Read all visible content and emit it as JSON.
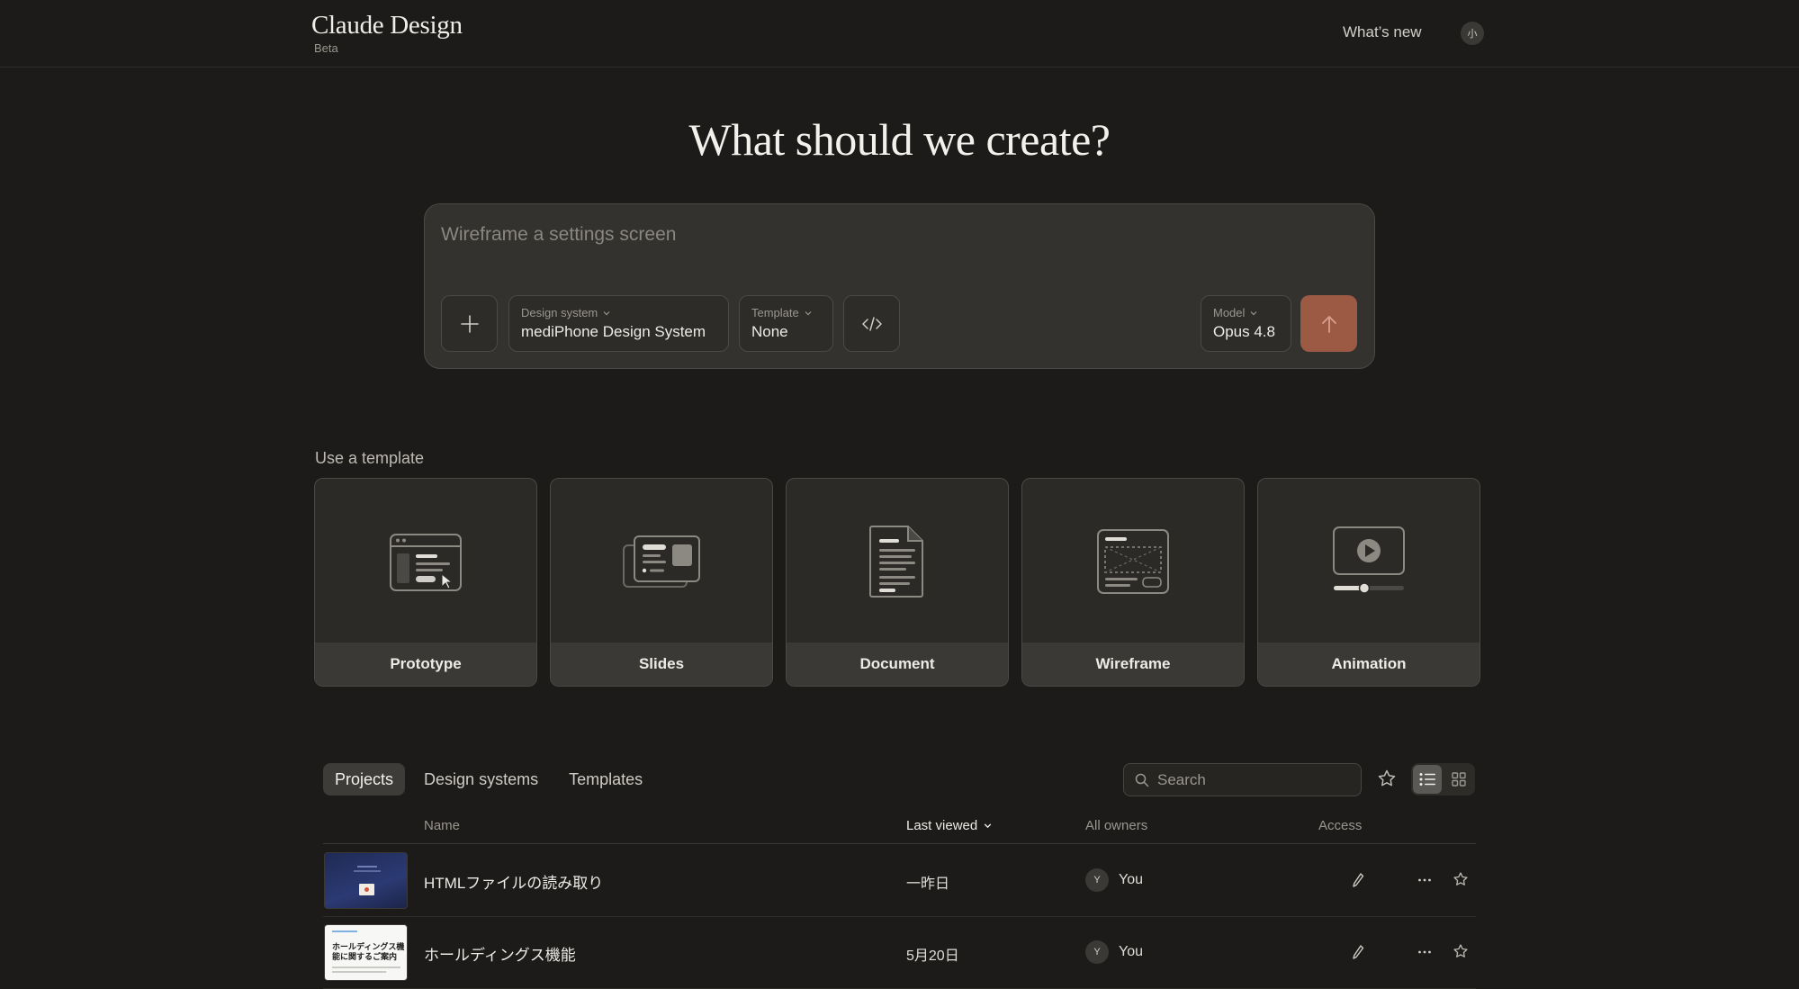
{
  "header": {
    "brand_title": "Claude Design",
    "brand_sub": "Beta",
    "whats_new": "What’s new",
    "avatar_initial": "小"
  },
  "hero": {
    "title": "What should we create?"
  },
  "prompt": {
    "placeholder": "Wireframe a settings screen",
    "design_system": {
      "label": "Design system",
      "value": "mediPhone Design System"
    },
    "template": {
      "label": "Template",
      "value": "None"
    },
    "model": {
      "label": "Model",
      "value": "Opus 4.8"
    },
    "send_color": "#9c5a45"
  },
  "templates": {
    "section_label": "Use a template",
    "items": [
      {
        "label": "Prototype",
        "icon": "prototype-icon"
      },
      {
        "label": "Slides",
        "icon": "slides-icon"
      },
      {
        "label": "Document",
        "icon": "document-icon"
      },
      {
        "label": "Wireframe",
        "icon": "wireframe-icon"
      },
      {
        "label": "Animation",
        "icon": "animation-icon"
      }
    ]
  },
  "tabs": [
    {
      "label": "Projects",
      "active": true
    },
    {
      "label": "Design systems",
      "active": false
    },
    {
      "label": "Templates",
      "active": false
    }
  ],
  "search": {
    "placeholder": "Search"
  },
  "table": {
    "columns": {
      "name": "Name",
      "last_viewed": "Last viewed",
      "owners": "All owners",
      "access": "Access"
    },
    "rows": [
      {
        "name": "HTMLファイルの読み取り",
        "date": "一昨日",
        "owner_initial": "Y",
        "owner": "You"
      },
      {
        "name": "ホールディングス機能",
        "date": "5月20日",
        "owner_initial": "Y",
        "owner": "You",
        "thumb_text": "ホールディングス機能に関するご案内"
      }
    ]
  }
}
